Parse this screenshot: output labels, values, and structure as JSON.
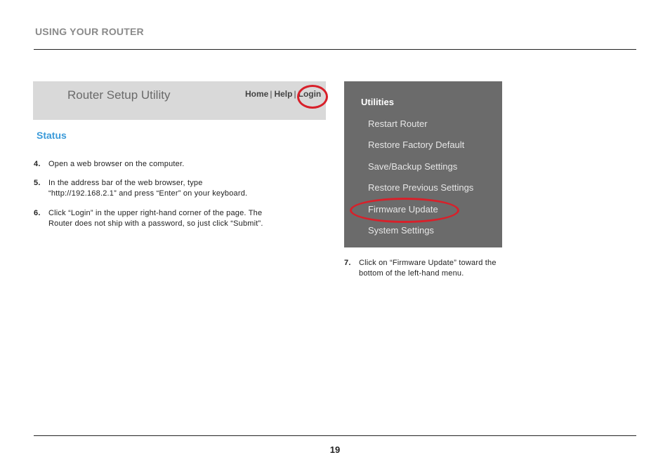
{
  "header": {
    "section_title": "USING YOUR ROUTER"
  },
  "router_screen": {
    "title": "Router Setup Utility",
    "nav": {
      "home": "Home",
      "help": "Help",
      "login": "Login",
      "separator": "|"
    },
    "status_heading": "Status",
    "highlight_color": "#d8202a"
  },
  "steps": [
    {
      "number": "4.",
      "lines": [
        "Open a web browser on the computer."
      ]
    },
    {
      "number": "5.",
      "lines": [
        "In the address bar of the web browser, type",
        "“http://192.168.2.1” and press “Enter” on your keyboard."
      ]
    },
    {
      "number": "6.",
      "lines": [
        "Click “Login” in the upper right-hand corner of the page. The",
        "Router does not ship with a password, so just click “Submit”."
      ]
    },
    {
      "number": "7.",
      "lines": [
        "Click on “Firmware Update” toward the",
        "bottom of the left-hand menu."
      ]
    }
  ],
  "utilities_menu": {
    "title": "Utilities",
    "items": [
      "Restart Router",
      "Restore Factory Default",
      "Save/Backup Settings",
      "Restore Previous Settings",
      "Firmware Update",
      "System Settings"
    ]
  },
  "footer": {
    "page_number": "19"
  }
}
